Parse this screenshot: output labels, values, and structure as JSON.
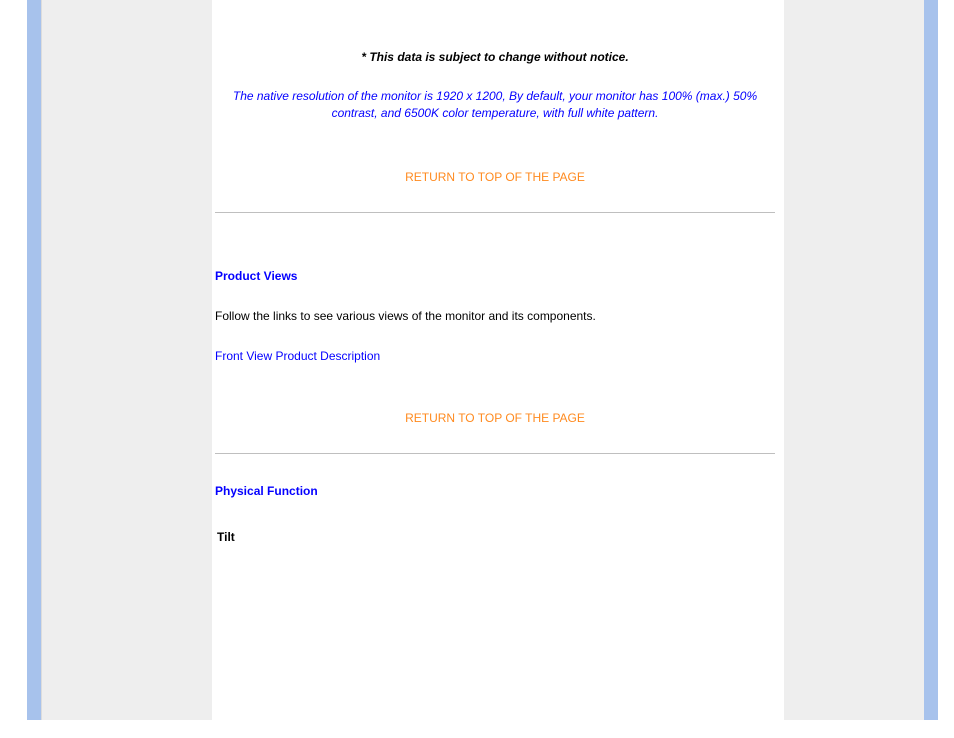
{
  "notice": "* This data is subject to change without notice.",
  "blue_note": "The native resolution of the monitor is 1920 x 1200, By default, your monitor has 100% (max.) 50% contrast, and 6500K color temperature, with full white pattern.",
  "return_link": "RETURN TO TOP OF THE PAGE",
  "sections": {
    "product_views": {
      "heading": "Product Views",
      "body": "Follow the links to see various views of the monitor and its components.",
      "link": "Front View Product Description"
    },
    "physical_function": {
      "heading": "Physical Function",
      "sub": "Tilt"
    }
  }
}
